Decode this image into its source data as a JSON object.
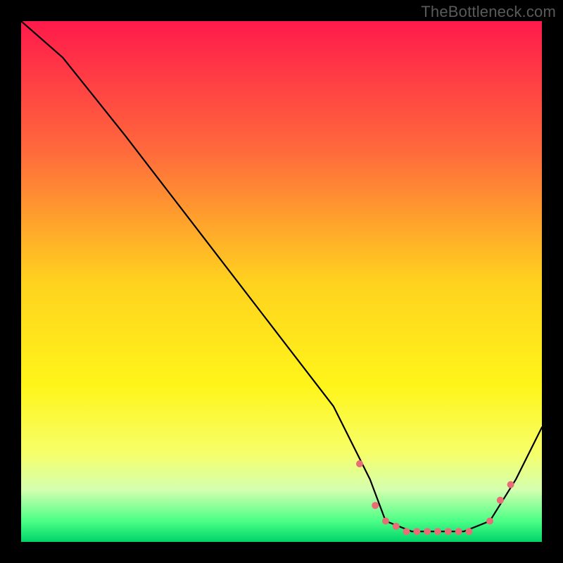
{
  "watermark": "TheBottleneck.com",
  "chart_data": {
    "type": "line",
    "title": "",
    "xlabel": "",
    "ylabel": "",
    "xlim": [
      0,
      100
    ],
    "ylim": [
      0,
      100
    ],
    "grid": false,
    "legend": false,
    "gradient_stops": [
      {
        "offset": 0,
        "color": "#ff1a4b"
      },
      {
        "offset": 0.25,
        "color": "#ff6a3c"
      },
      {
        "offset": 0.5,
        "color": "#ffd21f"
      },
      {
        "offset": 0.7,
        "color": "#fff51a"
      },
      {
        "offset": 0.83,
        "color": "#f6ff6a"
      },
      {
        "offset": 0.9,
        "color": "#d4ffb0"
      },
      {
        "offset": 0.96,
        "color": "#4bff86"
      },
      {
        "offset": 1.0,
        "color": "#00d46a"
      }
    ],
    "series": [
      {
        "name": "curve",
        "x": [
          0,
          8,
          20,
          30,
          40,
          50,
          60,
          67,
          70,
          75,
          80,
          85,
          90,
          95,
          100
        ],
        "y": [
          100,
          93,
          78,
          65,
          52,
          39,
          26,
          12,
          4,
          2,
          2,
          2,
          4,
          12,
          22
        ]
      }
    ],
    "markers": {
      "name": "highlight-points",
      "color": "#e96d77",
      "radius": 5,
      "x": [
        65,
        68,
        70,
        72,
        74,
        76,
        78,
        80,
        82,
        84,
        86,
        90,
        92,
        94
      ],
      "y": [
        15,
        7,
        4,
        3,
        2,
        2,
        2,
        2,
        2,
        2,
        2,
        4,
        8,
        11
      ]
    }
  }
}
